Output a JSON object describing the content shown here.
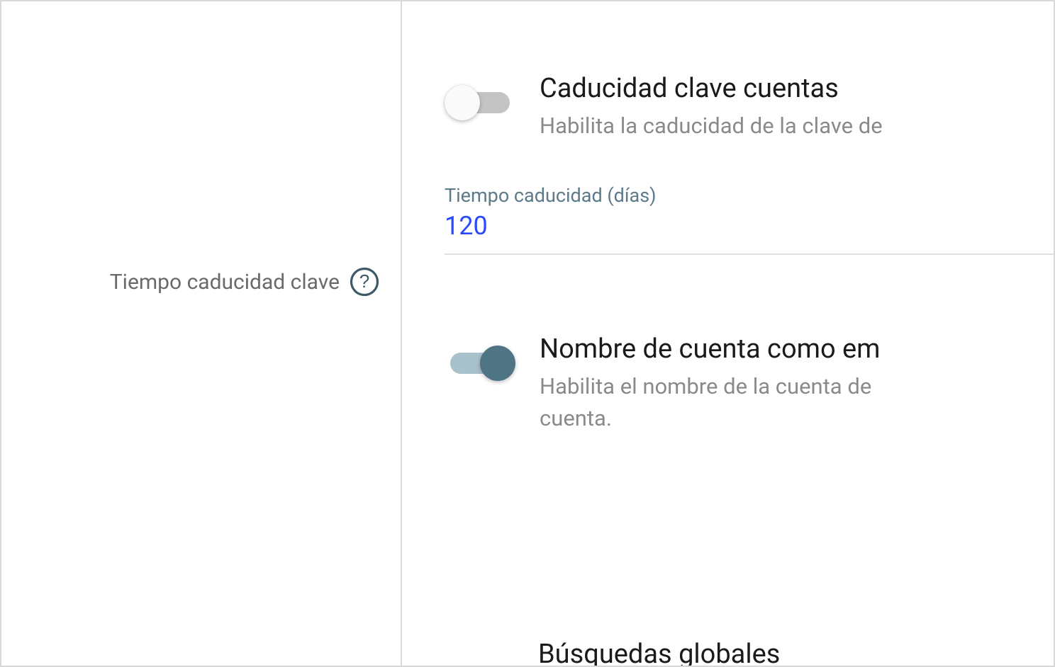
{
  "leftPanel": {
    "label": "Tiempo caducidad clave"
  },
  "settings": {
    "passwordExpiry": {
      "title": "Caducidad clave cuentas",
      "description": "Habilita la caducidad de la clave de",
      "enabled": false
    },
    "expiryInput": {
      "label": "Tiempo caducidad (días)",
      "value": "120"
    },
    "accountNameAsEmail": {
      "title": "Nombre de cuenta como em",
      "descriptionLine1": "Habilita el nombre de la cuenta de",
      "descriptionLine2": "cuenta.",
      "enabled": true
    },
    "globalSearches": {
      "title": "Búsquedas globales"
    }
  }
}
